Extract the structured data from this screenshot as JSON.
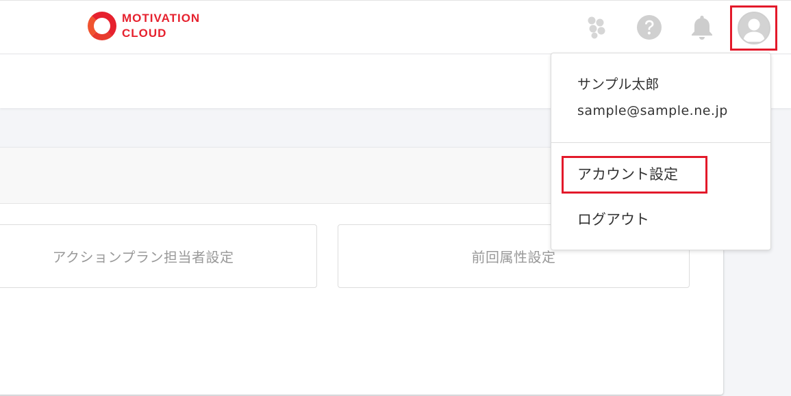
{
  "header": {
    "logo": {
      "line1": "MOTIVATION",
      "line2": "CLOUD",
      "brand_color": "#e6212e"
    },
    "icons": [
      "apps-icon",
      "help-icon",
      "bell-icon",
      "user-avatar-icon"
    ]
  },
  "main": {
    "tiles": [
      {
        "label": "アクションプラン担当者設定"
      },
      {
        "label": "前回属性設定"
      }
    ]
  },
  "account_menu": {
    "user_name": "サンプル太郎",
    "email": "sample@sample.ne.jp",
    "items": [
      {
        "label": "アカウント設定"
      },
      {
        "label": "ログアウト"
      }
    ]
  },
  "colors": {
    "highlight": "#e3192a",
    "icon_gray": "#cfcfcf",
    "tile_text": "#999999"
  }
}
